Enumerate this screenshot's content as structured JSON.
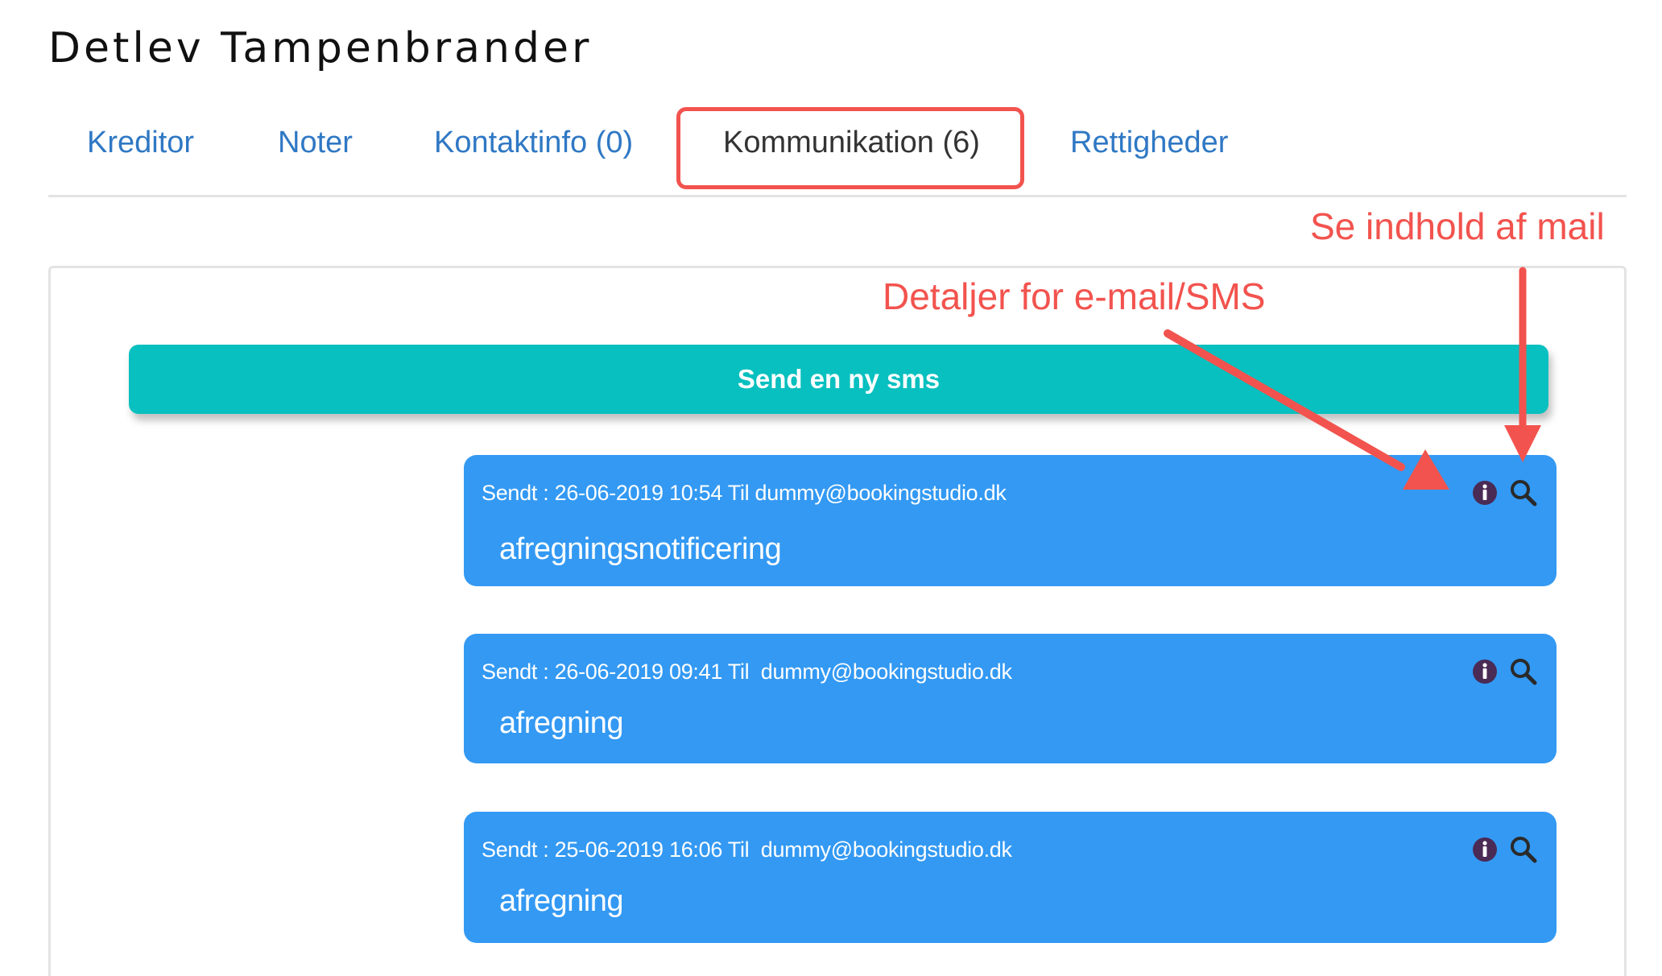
{
  "page": {
    "title": "Detlev Tampenbrander"
  },
  "tabs": [
    {
      "label": "Kreditor"
    },
    {
      "label": "Noter"
    },
    {
      "label": "Kontaktinfo (0)"
    },
    {
      "label": "Kommunikation (6)"
    },
    {
      "label": "Rettigheder"
    }
  ],
  "active_tab": "Kommunikation (6)",
  "send_button": {
    "label": "Send en ny sms"
  },
  "messages": [
    {
      "meta": "Sendt : 26-06-2019 10:54 Til dummy@bookingstudio.dk",
      "subject": "afregningsnotificering"
    },
    {
      "meta": "Sendt : 26-06-2019 09:41 Til  dummy@bookingstudio.dk",
      "subject": "afregning"
    },
    {
      "meta": "Sendt : 25-06-2019 16:06 Til  dummy@bookingstudio.dk",
      "subject": "afregning"
    }
  ],
  "annotations": {
    "view_mail": "Se indhold af mail",
    "details": "Detaljer for e-mail/SMS"
  },
  "icons": {
    "info": "info-icon",
    "search": "search-icon"
  },
  "colors": {
    "tab_link": "#2f78c4",
    "highlight": "#f2534e",
    "send_button": "#08c0bf",
    "message_bg": "#3399f3",
    "annotation": "#f2534e"
  }
}
